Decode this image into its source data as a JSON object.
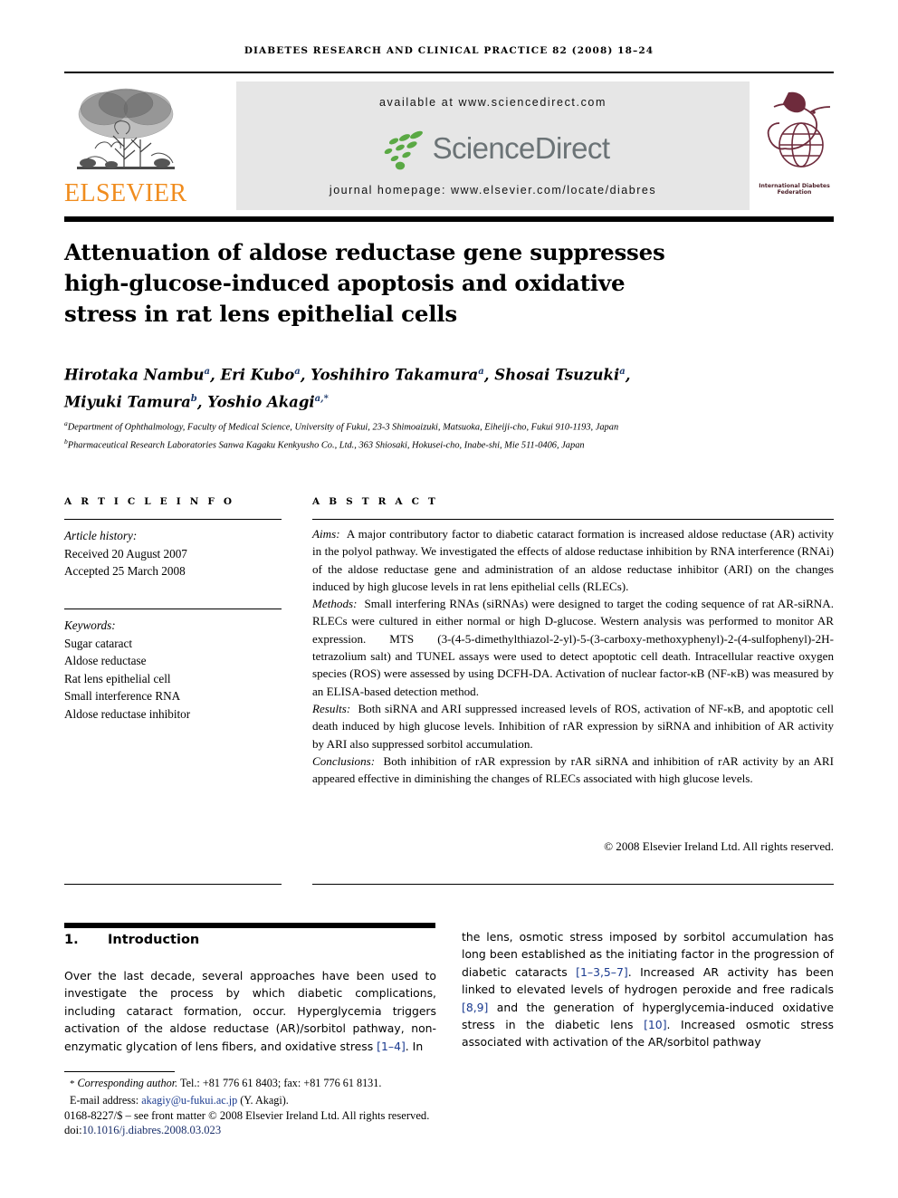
{
  "journal": {
    "running_head": "DIABETES RESEARCH AND CLINICAL PRACTICE 82 (2008) 18–24",
    "available_at": "available at www.sciencedirect.com",
    "homepage": "journal homepage: www.elsevier.com/locate/diabres",
    "publisher_name": "ELSEVIER",
    "sciencedirect_name": "ScienceDirect",
    "society_name": "International Diabetes Federation"
  },
  "article": {
    "title": "Attenuation of aldose reductase gene suppresses high-glucose-induced apoptosis and oxidative stress in rat lens epithelial cells",
    "authors_line1_prefix": "Hirotaka Nambu",
    "authors": "Hirotaka Nambu a, Eri Kubo a, Yoshihiro Takamura a, Shosai Tsuzuki a, Miyuki Tamura b, Yoshio Akagi a,*",
    "affiliation_a": "Department of Ophthalmology, Faculty of Medical Science, University of Fukui, 23-3 Shimoaizuki, Matsuoka, Eiheiji-cho, Fukui 910-1193, Japan",
    "affiliation_b": "Pharmaceutical Research Laboratories Sanwa Kagaku Kenkyusho Co., Ltd., 363 Shiosaki, Hokusei-cho, Inabe-shi, Mie 511-0406, Japan"
  },
  "article_info": {
    "heading": "A R T I C L E   I N F O",
    "history_label": "Article history:",
    "received": "Received 20 August 2007",
    "accepted": "Accepted 25 March 2008",
    "keywords_label": "Keywords:",
    "keywords": [
      "Sugar cataract",
      "Aldose reductase",
      "Rat lens epithelial cell",
      "Small interference RNA",
      "Aldose reductase inhibitor"
    ]
  },
  "abstract": {
    "heading": "A B S T R A C T",
    "aims_label": "Aims:",
    "aims_text": "A major contributory factor to diabetic cataract formation is increased aldose reductase (AR) activity in the polyol pathway. We investigated the effects of aldose reductase inhibition by RNA interference (RNAi) of the aldose reductase gene and administration of an aldose reductase inhibitor (ARI) on the changes induced by high glucose levels in rat lens epithelial cells (RLECs).",
    "methods_label": "Methods:",
    "methods_text": "Small interfering RNAs (siRNAs) were designed to target the coding sequence of rat AR-siRNA. RLECs were cultured in either normal or high D-glucose. Western analysis was performed to monitor AR expression. MTS (3-(4-5-dimethylthiazol-2-yl)-5-(3-carboxy-methoxyphenyl)-2-(4-sulfophenyl)-2H-tetrazolium salt) and TUNEL assays were used to detect apoptotic cell death. Intracellular reactive oxygen species (ROS) were assessed by using DCFH-DA. Activation of nuclear factor-κB (NF-κB) was measured by an ELISA-based detection method.",
    "results_label": "Results:",
    "results_text": "Both siRNA and ARI suppressed increased levels of ROS, activation of NF-κB, and apoptotic cell death induced by high glucose levels. Inhibition of rAR expression by siRNA and inhibition of AR activity by ARI also suppressed sorbitol accumulation.",
    "conclusions_label": "Conclusions:",
    "conclusions_text": "Both inhibition of rAR expression by rAR siRNA and inhibition of rAR activity by an ARI appeared effective in diminishing the changes of RLECs associated with high glucose levels.",
    "copyright": "© 2008 Elsevier Ireland Ltd. All rights reserved."
  },
  "introduction": {
    "number": "1.",
    "heading": "Introduction",
    "left_text_a": "Over the last decade, several approaches have been used to investigate the process by which diabetic complications, including cataract formation, occur. Hyperglycemia triggers activation of the aldose reductase (AR)/sorbitol pathway, non-enzymatic glycation of lens fibers, and oxidative stress ",
    "left_cite_1": "[1–4]",
    "left_text_b": ". In",
    "right_text_a": "the lens, osmotic stress imposed by sorbitol accumulation has long been established as the initiating factor in the progression of diabetic cataracts ",
    "right_cite_1": "[1–3,5–7]",
    "right_text_b": ". Increased AR activity has been linked to elevated levels of hydrogen peroxide and free radicals ",
    "right_cite_2": "[8,9]",
    "right_text_c": " and the generation of hyperglycemia-induced oxidative stress in the diabetic lens ",
    "right_cite_3": "[10]",
    "right_text_d": ". Increased osmotic stress associated with activation of the AR/sorbitol pathway"
  },
  "footer": {
    "corresponding_star": "*",
    "corresponding_label": "Corresponding author.",
    "corresponding_contact": " Tel.: +81 776 61 8403; fax: +81 776 61 8131.",
    "email_label": "E-mail address:",
    "email": "akagiy@u-fukui.ac.jp",
    "email_suffix": "(Y. Akagi).",
    "front_matter": "0168-8227/$ – see front matter © 2008 Elsevier Ireland Ltd. All rights reserved.",
    "doi_prefix": "doi:",
    "doi": "10.1016/j.diabres.2008.03.023"
  },
  "colors": {
    "elsevier_orange": "#f08c1e",
    "sciencedirect_green": "#5aa944",
    "sciencedirect_grey": "#6b7376",
    "idf_maroon": "#6e2b3c",
    "link_blue": "#1a3a8f"
  }
}
